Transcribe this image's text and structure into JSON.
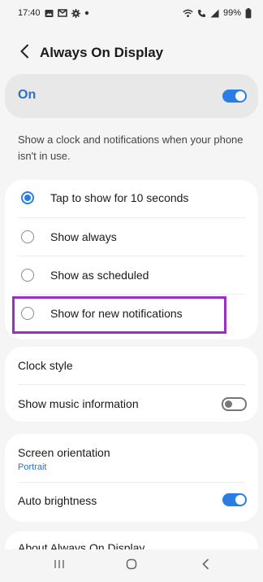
{
  "status_bar": {
    "time": "17:40",
    "battery": "99%",
    "icons_left": [
      "gallery-icon",
      "gmail-icon",
      "settings-gear-icon",
      "dot-icon"
    ],
    "icons_right": [
      "wifi-icon",
      "call-icon",
      "signal-icon",
      "battery-icon"
    ]
  },
  "header": {
    "back_icon": "back-chevron-icon",
    "title": "Always On Display"
  },
  "master_switch": {
    "label": "On",
    "enabled": true
  },
  "description": "Show a clock and notifications when your phone isn't in use.",
  "display_modes": [
    {
      "label": "Tap to show for 10 seconds",
      "selected": true
    },
    {
      "label": "Show always",
      "selected": false
    },
    {
      "label": "Show as scheduled",
      "selected": false
    },
    {
      "label": "Show for new notifications",
      "selected": false
    }
  ],
  "style_settings": {
    "clock_style": "Clock style",
    "music_info": "Show music information",
    "music_info_enabled": false
  },
  "orientation": {
    "label": "Screen orientation",
    "value": "Portrait"
  },
  "auto_brightness": {
    "label": "Auto brightness",
    "enabled": true
  },
  "about": "About Always On Display",
  "nav_bar": {
    "recents_icon": "recents-icon",
    "home_icon": "home-icon",
    "back_icon": "back-icon"
  },
  "colors": {
    "accent": "#2a7ee3",
    "highlight_box": "#9b2fc2",
    "background": "#f5f5f5"
  }
}
